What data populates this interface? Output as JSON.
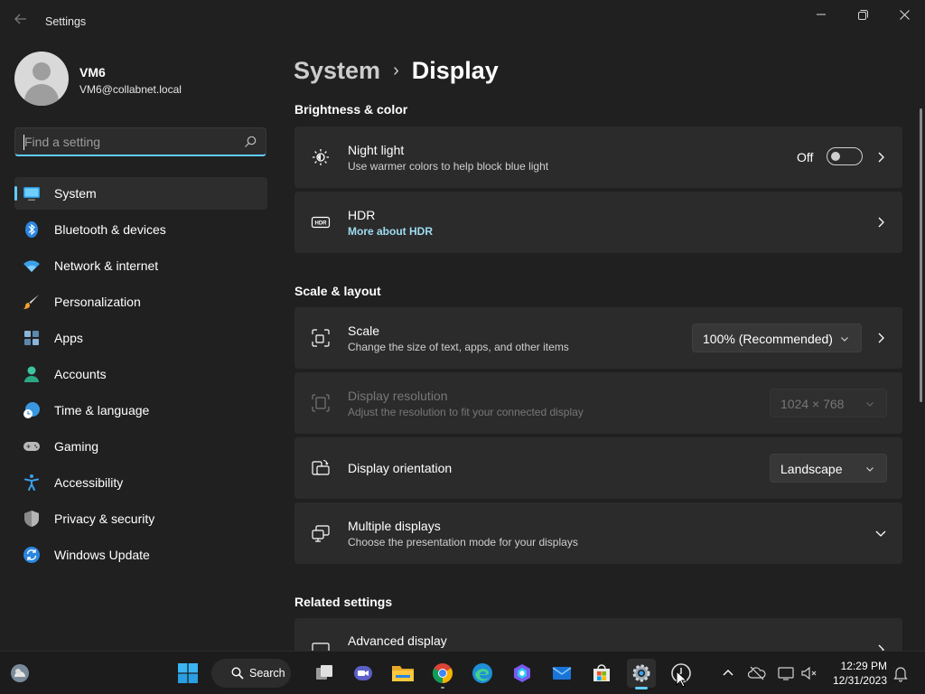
{
  "window": {
    "title": "Settings",
    "back_icon": "back-arrow-icon",
    "controls": [
      "minimize-icon",
      "maximize-icon",
      "close-icon"
    ]
  },
  "user": {
    "name": "VM6",
    "email": "VM6@collabnet.local"
  },
  "search": {
    "placeholder": "Find a setting"
  },
  "sidebar": {
    "items": [
      {
        "label": "System",
        "icon": "system-icon",
        "active": true
      },
      {
        "label": "Bluetooth & devices",
        "icon": "bluetooth-icon"
      },
      {
        "label": "Network & internet",
        "icon": "wifi-icon"
      },
      {
        "label": "Personalization",
        "icon": "brush-icon"
      },
      {
        "label": "Apps",
        "icon": "apps-icon"
      },
      {
        "label": "Accounts",
        "icon": "accounts-icon"
      },
      {
        "label": "Time & language",
        "icon": "time-language-icon"
      },
      {
        "label": "Gaming",
        "icon": "gamepad-icon"
      },
      {
        "label": "Accessibility",
        "icon": "accessibility-icon"
      },
      {
        "label": "Privacy & security",
        "icon": "shield-icon"
      },
      {
        "label": "Windows Update",
        "icon": "windows-update-icon"
      }
    ]
  },
  "breadcrumb": {
    "parent": "System",
    "separator": "›",
    "current": "Display"
  },
  "sections": {
    "brightness": "Brightness & color",
    "scale": "Scale & layout",
    "related": "Related settings"
  },
  "cards": {
    "night_light": {
      "title": "Night light",
      "subtitle": "Use warmer colors to help block blue light",
      "toggle_label": "Off",
      "toggle_on": false
    },
    "hdr": {
      "title": "HDR",
      "link": "More about HDR"
    },
    "scale": {
      "title": "Scale",
      "subtitle": "Change the size of text, apps, and other items",
      "value": "100% (Recommended)"
    },
    "resolution": {
      "title": "Display resolution",
      "subtitle": "Adjust the resolution to fit your connected display",
      "value": "1024 × 768",
      "disabled": true
    },
    "orientation": {
      "title": "Display orientation",
      "value": "Landscape"
    },
    "multiple": {
      "title": "Multiple displays",
      "subtitle": "Choose the presentation mode for your displays"
    },
    "advanced": {
      "title": "Advanced display"
    }
  },
  "taskbar": {
    "search_label": "Search",
    "apps": [
      "widgets-icon",
      "start-icon",
      "task-view-icon",
      "meet-icon",
      "file-explorer-icon",
      "chrome-icon",
      "edge-icon",
      "copilot-icon",
      "mail-icon",
      "store-icon",
      "settings-icon",
      "clock-app-icon"
    ],
    "tray": [
      "chevron-up-icon",
      "onedrive-icon",
      "display-icon",
      "speaker-icon",
      "notification-bell-icon"
    ],
    "time": "12:29 PM",
    "date": "12/31/2023"
  },
  "colors": {
    "accent": "#60cdff",
    "background": "#202020",
    "card": "#2b2b2b",
    "link": "#9fdcf2"
  }
}
